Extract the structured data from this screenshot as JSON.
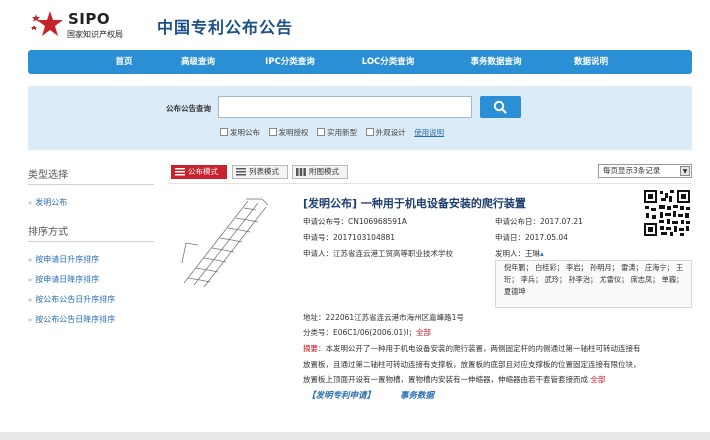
{
  "header": {
    "logo_text": "SIPO",
    "logo_subtext": "国家知识产权局",
    "site_title": "中国专利公布公告"
  },
  "nav": {
    "items": [
      "首页",
      "高级查询",
      "IPC分类查询",
      "LOC分类查询",
      "事务数据查询",
      "数据说明"
    ]
  },
  "search": {
    "label": "公布公告查询",
    "value": "",
    "checkboxes": [
      "发明公布",
      "发明授权",
      "实用新型",
      "外观设计"
    ],
    "help_link": "使用说明"
  },
  "sidebar": {
    "type_heading": "类型选择",
    "type_item": "发明公布",
    "sort_heading": "排序方式",
    "sort_items": [
      "按申请日升序排序",
      "按申请日降序排序",
      "按公布公告日升序排序",
      "按公布公告日降序排序"
    ]
  },
  "modes": {
    "tabs": [
      "公布模式",
      "列表模式",
      "附图模式"
    ],
    "per_page": "每页显示3条记录"
  },
  "result": {
    "title": "[发明公布] 一种用于机电设备安装的爬行装置",
    "pub_no_label": "申请公布号：",
    "pub_no": "CN106968591A",
    "pub_date_label": "申请公布日：",
    "pub_date": "2017.07.21",
    "app_no_label": "申请号：",
    "app_no": "2017103104881",
    "app_date_label": "申请日：",
    "app_date": "2017.05.04",
    "applicant_label": "申请人：",
    "applicant": "江苏省连云港工贸高等职业技术学校",
    "inventor_label": "发明人：",
    "inventor_first": "王琳",
    "inventors_more": [
      "倪年鹏；",
      "白桂彩；",
      "李岩；",
      "孙明月；",
      "雷涛；",
      "庄海宁；",
      "王",
      "珩；",
      "李兵；",
      "武玲；",
      "孙李治；",
      "尤雷仪；",
      "席志凤；",
      "单巍；",
      "夏德坤"
    ],
    "address_label": "地址：",
    "address": "222061江苏省连云港市海州区嘉峰路1号",
    "class_label": "分类号：",
    "class_no": "E06C1/06(2006.01)I；",
    "class_all": "全部",
    "abstract_label": "摘要：",
    "abstract_lines": [
      "本发明公开了一种用于机电设备安装的爬行装置，两侧固定杆的内侧通过第一轴柱可转动连接有",
      "放置板，且通过第二轴柱可转动连接有支撑板，放置板的底部且对应支撑板的位置固定连接有限位块，",
      "放置板上顶面开设有一置物槽，置物槽内安装有一伸缩器，伸缩器由若干套管套接而成"
    ],
    "abstract_all": "全部",
    "link_app": "【发明专利申请】",
    "link_data": "事务数据"
  },
  "colors": {
    "nav_blue": "#2a8fd4",
    "search_bg": "#dcebf8",
    "title_blue": "#1f3e6e",
    "active_red": "#c8232c"
  }
}
